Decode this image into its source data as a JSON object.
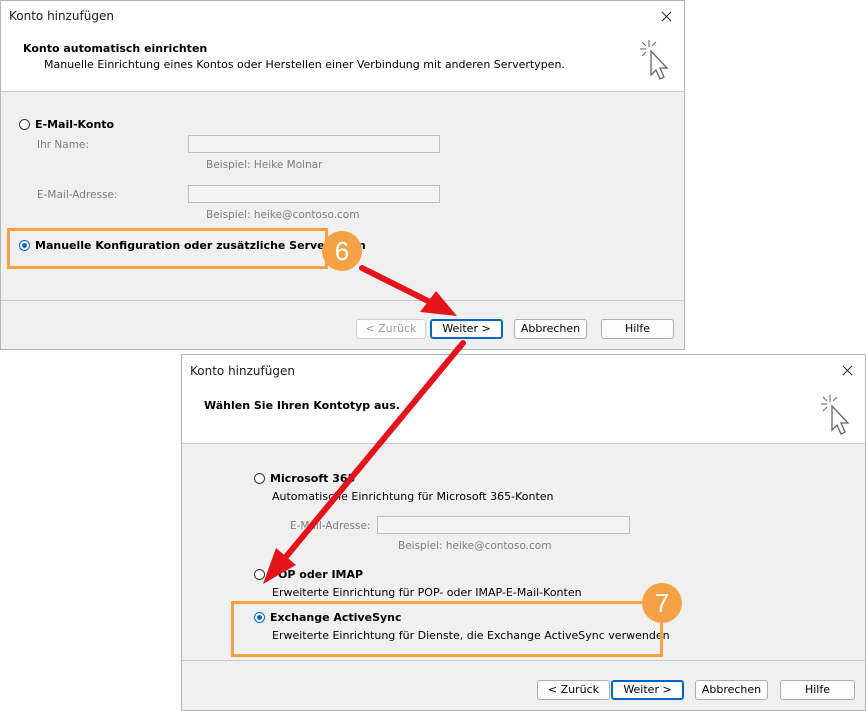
{
  "dialog1": {
    "title": "Konto hinzufügen",
    "header_title": "Konto automatisch einrichten",
    "header_subtitle": "Manuelle Einrichtung eines Kontos oder Herstellen einer Verbindung mit anderen Servertypen.",
    "option_email_label": "E-Mail-Konto",
    "name_label": "Ihr Name:",
    "name_value": "",
    "name_hint": "Beispiel: Heike Molnar",
    "email_label": "E-Mail-Adresse:",
    "email_value": "",
    "email_hint": "Beispiel: heike@contoso.com",
    "option_manual_label": "Manuelle Konfiguration oder zusätzliche Servertypen",
    "selected_option": "manual",
    "buttons": {
      "back": "< Zurück",
      "next": "Weiter >",
      "cancel": "Abbrechen",
      "help": "Hilfe"
    }
  },
  "dialog2": {
    "title": "Konto hinzufügen",
    "header_title": "Wählen Sie Ihren Kontotyp aus.",
    "option_m365_label": "Microsoft 365",
    "option_m365_desc": "Automatische Einrichtung für Microsoft 365-Konten",
    "email_label": "E-Mail-Adresse:",
    "email_value": "",
    "email_hint": "Beispiel: heike@contoso.com",
    "option_pop_label": "POP oder IMAP",
    "option_pop_desc": "Erweiterte Einrichtung für POP- oder IMAP-E-Mail-Konten",
    "option_eas_label": "Exchange ActiveSync",
    "option_eas_desc": "Erweiterte Einrichtung für Dienste, die Exchange ActiveSync verwenden",
    "selected_option": "eas",
    "buttons": {
      "back": "< Zurück",
      "next": "Weiter >",
      "cancel": "Abbrechen",
      "help": "Hilfe"
    }
  },
  "annotations": {
    "step1": "6",
    "step2": "7",
    "highlight_color": "#f5a246",
    "arrow_color": "#e3141b"
  }
}
